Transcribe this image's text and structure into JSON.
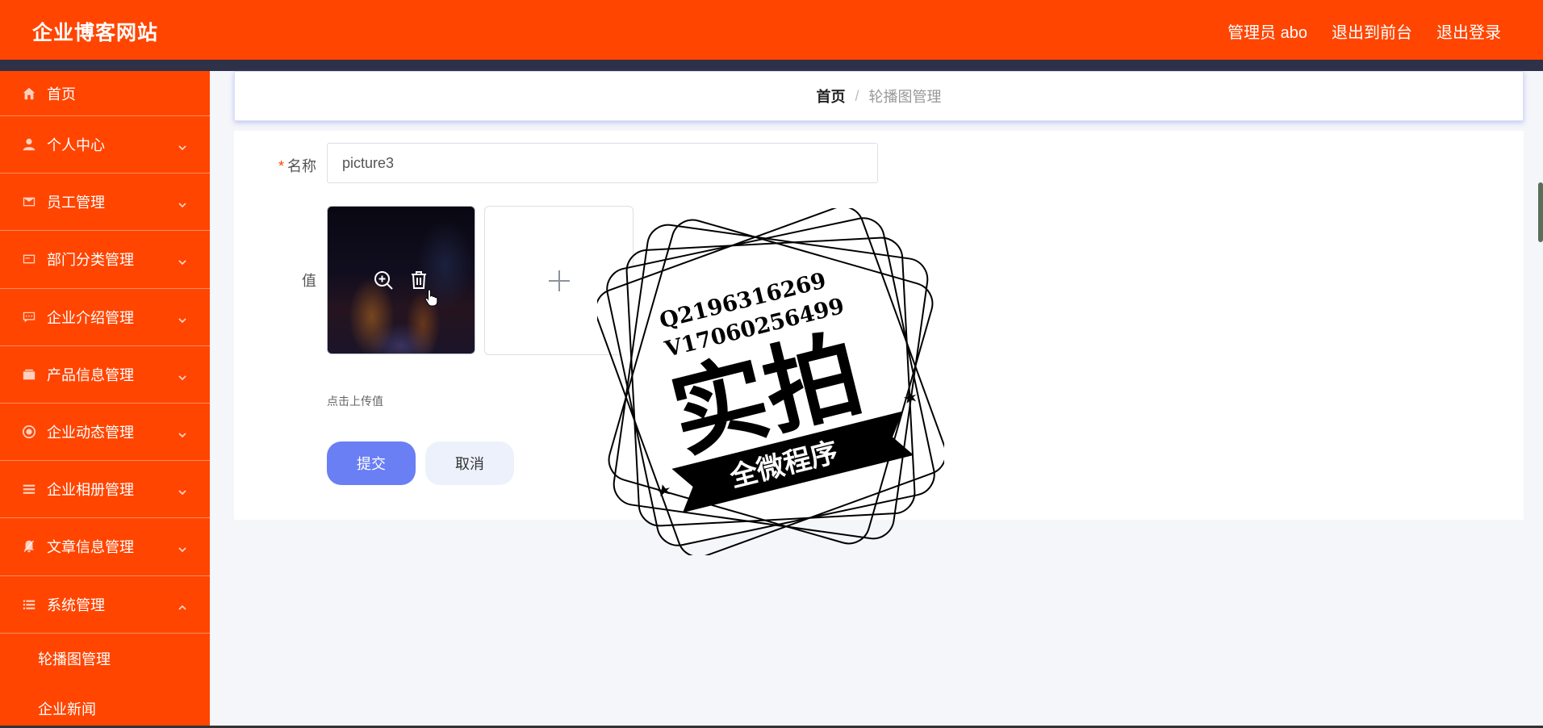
{
  "header": {
    "brand": "企业博客网站",
    "admin": "管理员 abo",
    "front": "退出到前台",
    "logout": "退出登录"
  },
  "sidebar": {
    "items": [
      {
        "label": "首页",
        "icon": "home-icon"
      },
      {
        "label": "个人中心",
        "icon": "user-icon"
      },
      {
        "label": "员工管理",
        "icon": "mail-icon"
      },
      {
        "label": "部门分类管理",
        "icon": "card-icon"
      },
      {
        "label": "企业介绍管理",
        "icon": "chat-icon"
      },
      {
        "label": "产品信息管理",
        "icon": "wallet-icon"
      },
      {
        "label": "企业动态管理",
        "icon": "target-icon"
      },
      {
        "label": "企业相册管理",
        "icon": "list-icon"
      },
      {
        "label": "文章信息管理",
        "icon": "bell-off-icon"
      },
      {
        "label": "系统管理",
        "icon": "menu-icon"
      }
    ],
    "sub_items": [
      "轮播图管理",
      "企业新闻"
    ]
  },
  "breadcrumb": {
    "home": "首页",
    "separator": "/",
    "current": "轮播图管理"
  },
  "form": {
    "name_label": "名称",
    "name_value": "picture3",
    "value_label": "值",
    "upload_hint": "点击上传值",
    "submit": "提交",
    "cancel": "取消"
  },
  "watermark": {
    "line1": "Q2196316269",
    "line2": "V17060256499",
    "main": "实拍",
    "ribbon": "全微程序"
  },
  "colors": {
    "brand": "#ff4500",
    "strip": "#2e3148",
    "primary": "#6a7ff4"
  }
}
